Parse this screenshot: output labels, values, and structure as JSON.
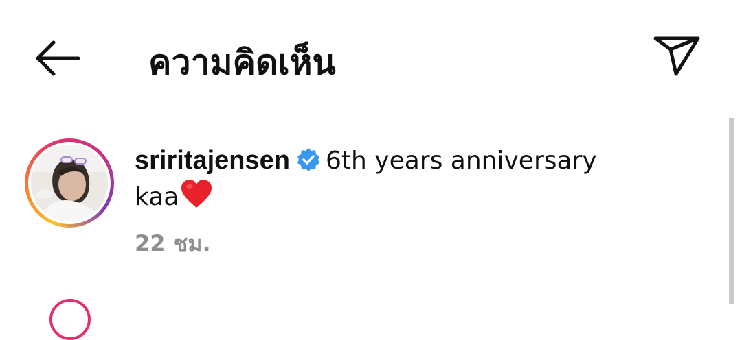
{
  "header": {
    "title": "ความคิดเห็น",
    "back_icon": "arrow-left-icon",
    "send_icon": "send-icon"
  },
  "comment": {
    "username": "sriritajensen",
    "verified": true,
    "caption_line1": "6th years anniversary",
    "caption_line2": "kaa",
    "emoji": "red-heart",
    "timestamp": "22 ชม."
  },
  "colors": {
    "verified": "#3897f0",
    "heart": "#e8212b",
    "timestamp": "#8e8e8e",
    "divider": "#e0e0e0"
  }
}
